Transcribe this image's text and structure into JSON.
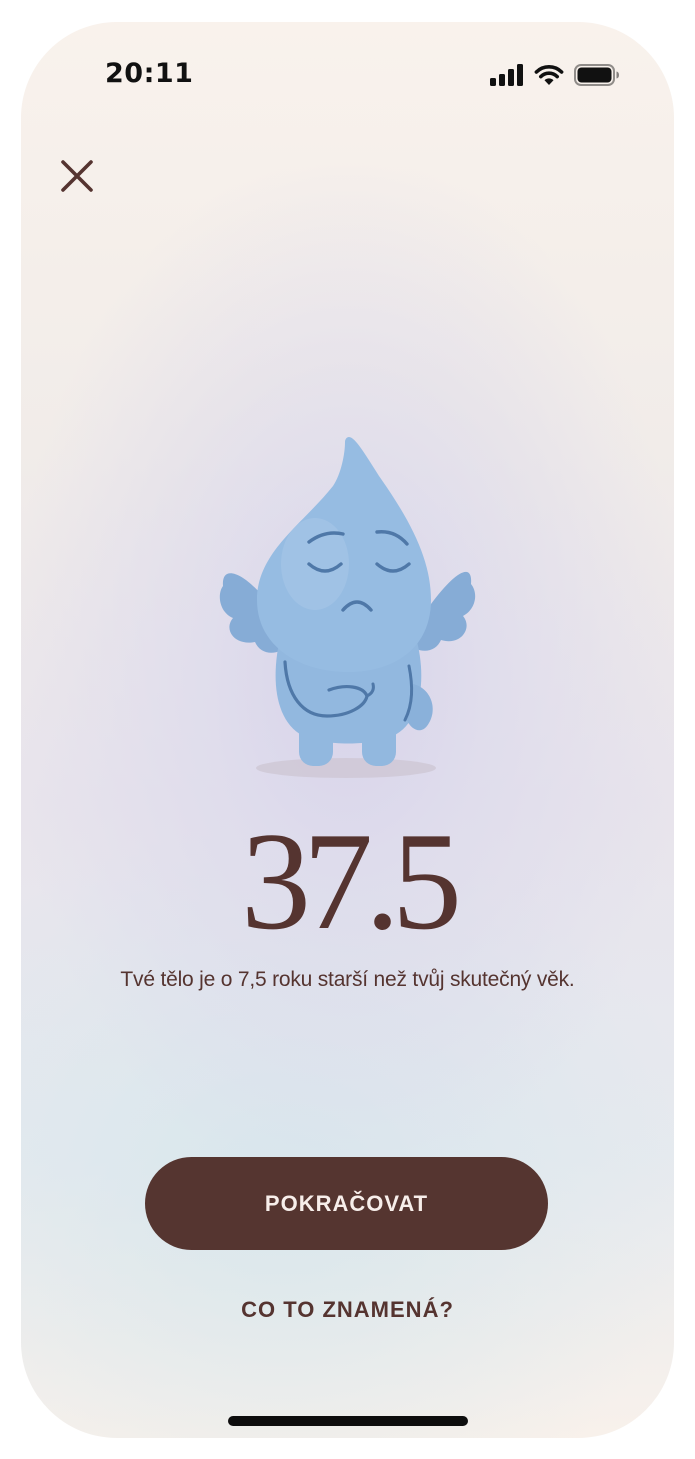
{
  "status_bar": {
    "time": "20:11",
    "icons": [
      "signal-icon",
      "wifi-icon",
      "battery-icon"
    ]
  },
  "header": {
    "close_icon": "close-icon"
  },
  "result": {
    "score": "37.5",
    "message": "Tvé tělo je o 7,5 roku starší než tvůj skutečný věk."
  },
  "actions": {
    "continue_label": "POKRAČOVAT",
    "meaning_label": "CO TO ZNAMENÁ?"
  },
  "colors": {
    "text": "#553430",
    "button_bg": "#553530",
    "button_text": "#f7eeea",
    "mascot": "#92b8df"
  }
}
